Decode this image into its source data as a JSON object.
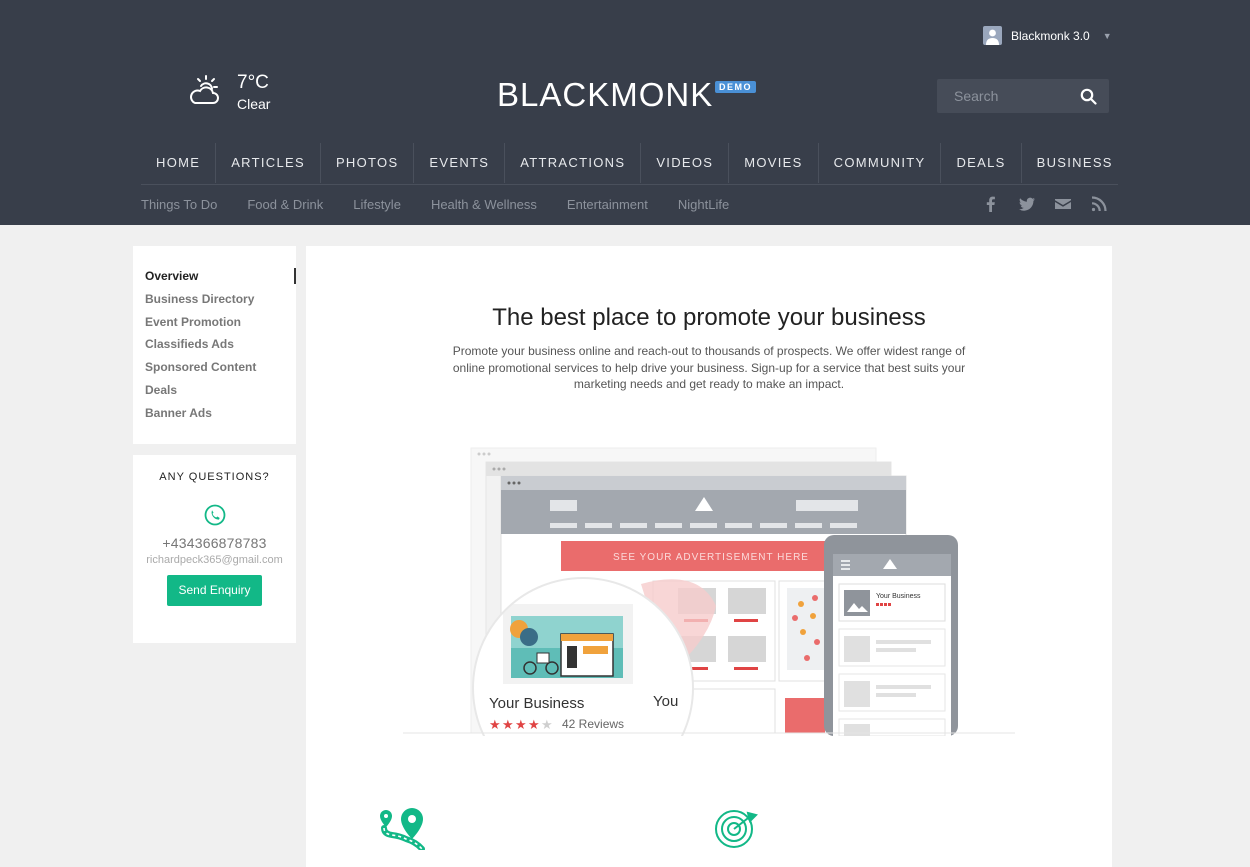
{
  "header": {
    "user": {
      "name": "Blackmonk 3.0"
    },
    "weather": {
      "icon": "partly-cloudy-icon",
      "temp": "7°C",
      "condition": "Clear"
    },
    "logo": {
      "text": "BLACKMONK",
      "badge": "DEMO"
    },
    "search": {
      "placeholder": "Search"
    },
    "main_nav": [
      "HOME",
      "ARTICLES",
      "PHOTOS",
      "EVENTS",
      "ATTRACTIONS",
      "VIDEOS",
      "MOVIES",
      "COMMUNITY",
      "DEALS",
      "BUSINESS"
    ],
    "sub_nav": [
      "Things To Do",
      "Food & Drink",
      "Lifestyle",
      "Health & Wellness",
      "Entertainment",
      "NightLife"
    ],
    "social": [
      "facebook-icon",
      "twitter-icon",
      "email-icon",
      "rss-icon"
    ]
  },
  "sidebar": {
    "items": [
      "Overview",
      "Business Directory",
      "Event Promotion",
      "Classifieds Ads",
      "Sponsored Content",
      "Deals",
      "Banner Ads"
    ],
    "active": "Overview"
  },
  "questions": {
    "title": "ANY QUESTIONS?",
    "phone": "+434366878783",
    "email": "richardpeck365@gmail.com",
    "button": "Send Enquiry"
  },
  "main": {
    "title": "The best place to promote your business",
    "description": "Promote your business online and reach-out to thousands of prospects. We offer widest range of online promotional services to help drive your business. Sign-up for a service that best suits your marketing needs and get ready to make an impact.",
    "illustration": {
      "ad_banner": "SEE YOUR ADVERTISEMENT HERE",
      "business_name": "Your Business",
      "business_name_cut": "You",
      "reviews": "42 Reviews",
      "rating": 4,
      "rating_max": 5,
      "brand_color": "#ea6c6c",
      "star_color": "#e04444"
    }
  },
  "colors": {
    "header_bg": "#383e4a",
    "accent_green": "#12b887",
    "demo_badge": "#4a90d6"
  }
}
